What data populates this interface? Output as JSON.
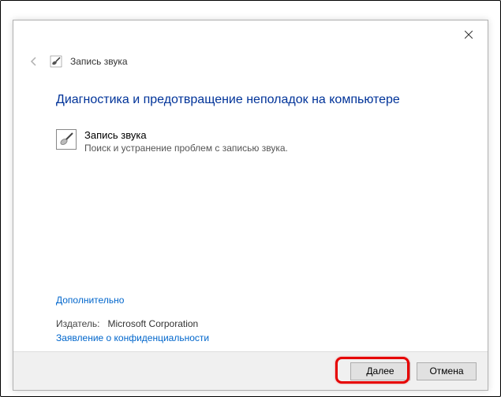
{
  "window": {
    "title": "Запись звука"
  },
  "content": {
    "heading": "Диагностика и предотвращение неполадок на компьютере",
    "troubleshooter_name": "Запись звука",
    "troubleshooter_desc": "Поиск и устранение проблем с записью звука."
  },
  "links": {
    "advanced": "Дополнительно",
    "privacy": "Заявление о конфиденциальности"
  },
  "publisher": {
    "label": "Издатель:",
    "value": "Microsoft Corporation"
  },
  "footer": {
    "next": "Далее",
    "cancel": "Отмена"
  }
}
